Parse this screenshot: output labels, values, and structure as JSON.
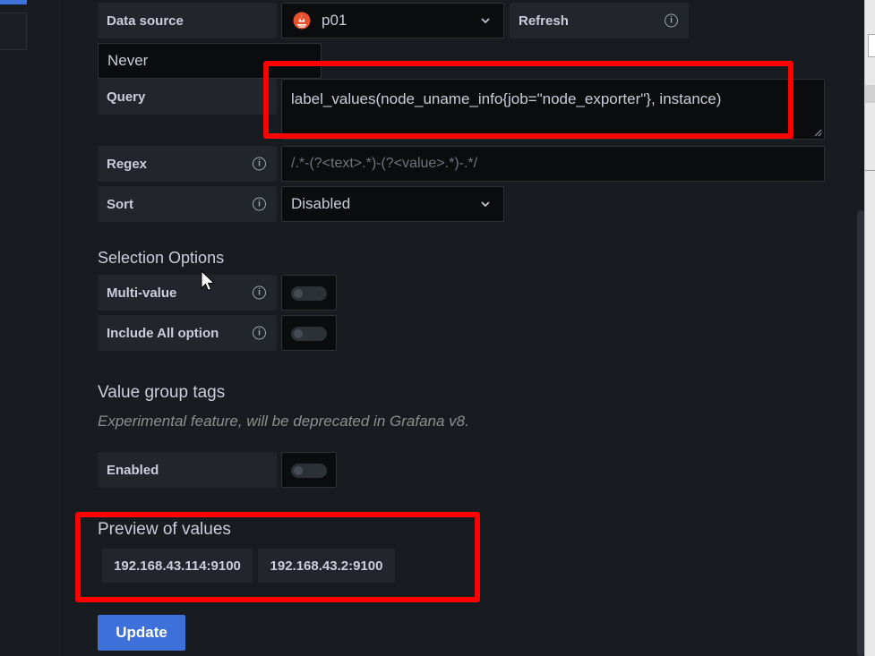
{
  "datasource": {
    "label": "Data source",
    "value": "p01",
    "icon": "prometheus-icon"
  },
  "refresh": {
    "label": "Refresh",
    "value": "Never"
  },
  "query": {
    "label": "Query",
    "value": "label_values(node_uname_info{job=\"node_exporter\"}, instance)"
  },
  "regex": {
    "label": "Regex",
    "placeholder": "/.*-(?<text>.*)-(?<value>.*)-.*/"
  },
  "sort": {
    "label": "Sort",
    "value": "Disabled"
  },
  "selection": {
    "title": "Selection Options",
    "multi_value": {
      "label": "Multi-value",
      "enabled": false
    },
    "include_all": {
      "label": "Include All option",
      "enabled": false
    }
  },
  "value_group_tags": {
    "title": "Value group tags",
    "description": "Experimental feature, will be deprecated in Grafana v8.",
    "enabled": {
      "label": "Enabled",
      "enabled": false
    }
  },
  "preview": {
    "title": "Preview of values",
    "values": [
      "192.168.43.114:9100",
      "192.168.43.2:9100"
    ]
  },
  "update_button": {
    "label": "Update"
  },
  "colors": {
    "accent": "#3d71d9",
    "highlight": "#ff0000",
    "prometheus": "#e6522c"
  }
}
